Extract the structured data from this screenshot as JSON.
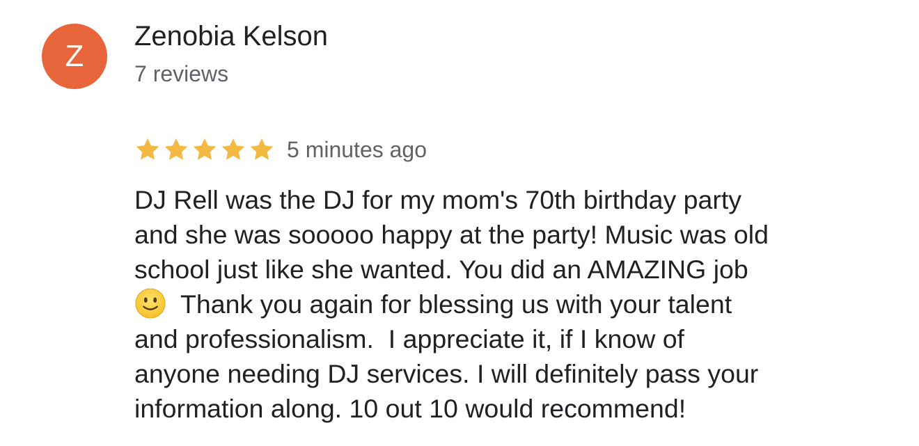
{
  "reviewer": {
    "initial": "Z",
    "name": "Zenobia Kelson",
    "review_count": "7 reviews",
    "avatar_color": "#e8643a"
  },
  "rating": {
    "stars": 5,
    "max_stars": 5,
    "star_color": "#f4b942",
    "timestamp": "5 minutes ago"
  },
  "review": {
    "lines": [
      "DJ Rell was the DJ for my mom's 70th birthday party",
      "and she was sooooo happy at the party! Music was old",
      "school just like she wanted. You did an AMAZING job",
      "Thank you again for blessing us with your talent",
      "and professionalism.  I appreciate it, if I know of",
      "anyone needing DJ services. I will definitely pass your",
      "information along. 10 out 10 would recommend!"
    ],
    "emoji": "slightly-smiling-face-icon"
  }
}
